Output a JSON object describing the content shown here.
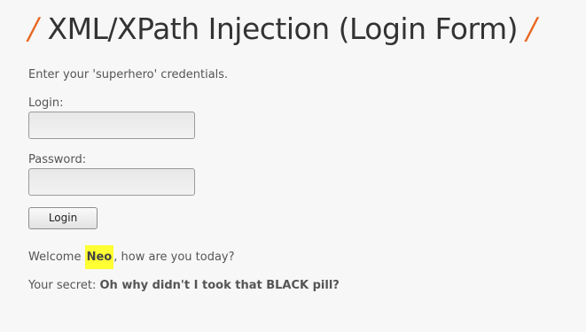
{
  "header": {
    "slash_left": "/",
    "title": "XML/XPath Injection (Login Form)",
    "slash_right": "/"
  },
  "form": {
    "intro": "Enter your 'superhero' credentials.",
    "login_label": "Login:",
    "login_value": "",
    "password_label": "Password:",
    "password_value": "",
    "submit_label": "Login"
  },
  "result": {
    "welcome_prefix": "Welcome ",
    "username": "Neo",
    "welcome_suffix": ", how are you today?",
    "secret_label": "Your secret: ",
    "secret_value": "Oh why didn't I took that BLACK pill?"
  },
  "colors": {
    "accent": "#e8661f",
    "highlight": "#ffff33",
    "background": "#f7f7f7"
  }
}
